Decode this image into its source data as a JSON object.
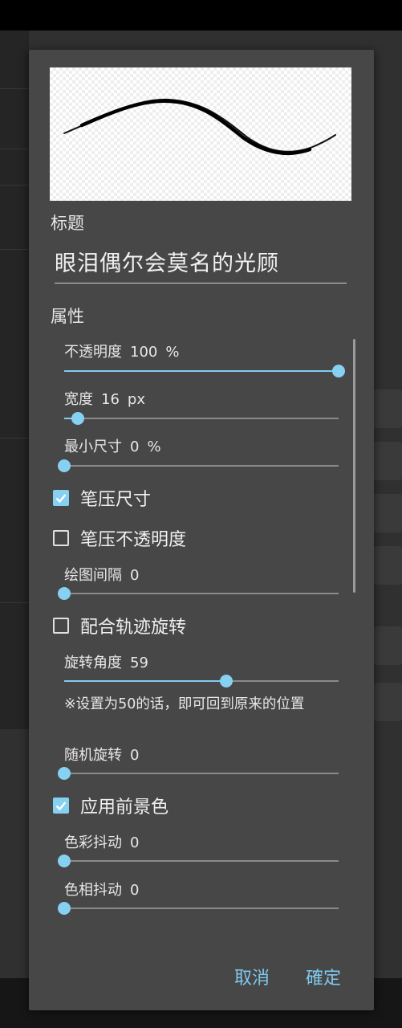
{
  "dialog": {
    "title_label": "标题",
    "title_value": "眼泪偶尔会莫名的光顾",
    "properties_label": "属性",
    "sliders": [
      {
        "id": "opacity",
        "label": "不透明度",
        "value": "100",
        "unit": "%",
        "fraction": 1.0
      },
      {
        "id": "width",
        "label": "宽度",
        "value": "16",
        "unit": "px",
        "fraction": 0.05
      },
      {
        "id": "min-size",
        "label": "最小尺寸",
        "value": "0",
        "unit": "%",
        "fraction": 0.0
      },
      {
        "id": "spacing",
        "label": "绘图间隔",
        "value": "0",
        "unit": "",
        "fraction": 0.0
      },
      {
        "id": "rotation-angle",
        "label": "旋转角度",
        "value": "59",
        "unit": "",
        "fraction": 0.59
      },
      {
        "id": "random-rotation",
        "label": "随机旋转",
        "value": "0",
        "unit": "",
        "fraction": 0.0
      },
      {
        "id": "color-jitter",
        "label": "色彩抖动",
        "value": "0",
        "unit": "",
        "fraction": 0.0
      },
      {
        "id": "hue-jitter",
        "label": "色相抖动",
        "value": "0",
        "unit": "",
        "fraction": 0.0
      }
    ],
    "checkboxes": [
      {
        "id": "pressure-size",
        "label": "笔压尺寸",
        "checked": true
      },
      {
        "id": "pressure-opacity",
        "label": "笔压不透明度",
        "checked": false
      },
      {
        "id": "follow-rotation",
        "label": "配合轨迹旋转",
        "checked": false
      },
      {
        "id": "foreground-color",
        "label": "应用前景色",
        "checked": true
      }
    ],
    "rotation_note": "※设置为50的话，即可回到原来的位置",
    "cancel_label": "取消",
    "ok_label": "確定"
  },
  "colors": {
    "accent": "#86d0f2",
    "dialog_bg": "#474747"
  }
}
